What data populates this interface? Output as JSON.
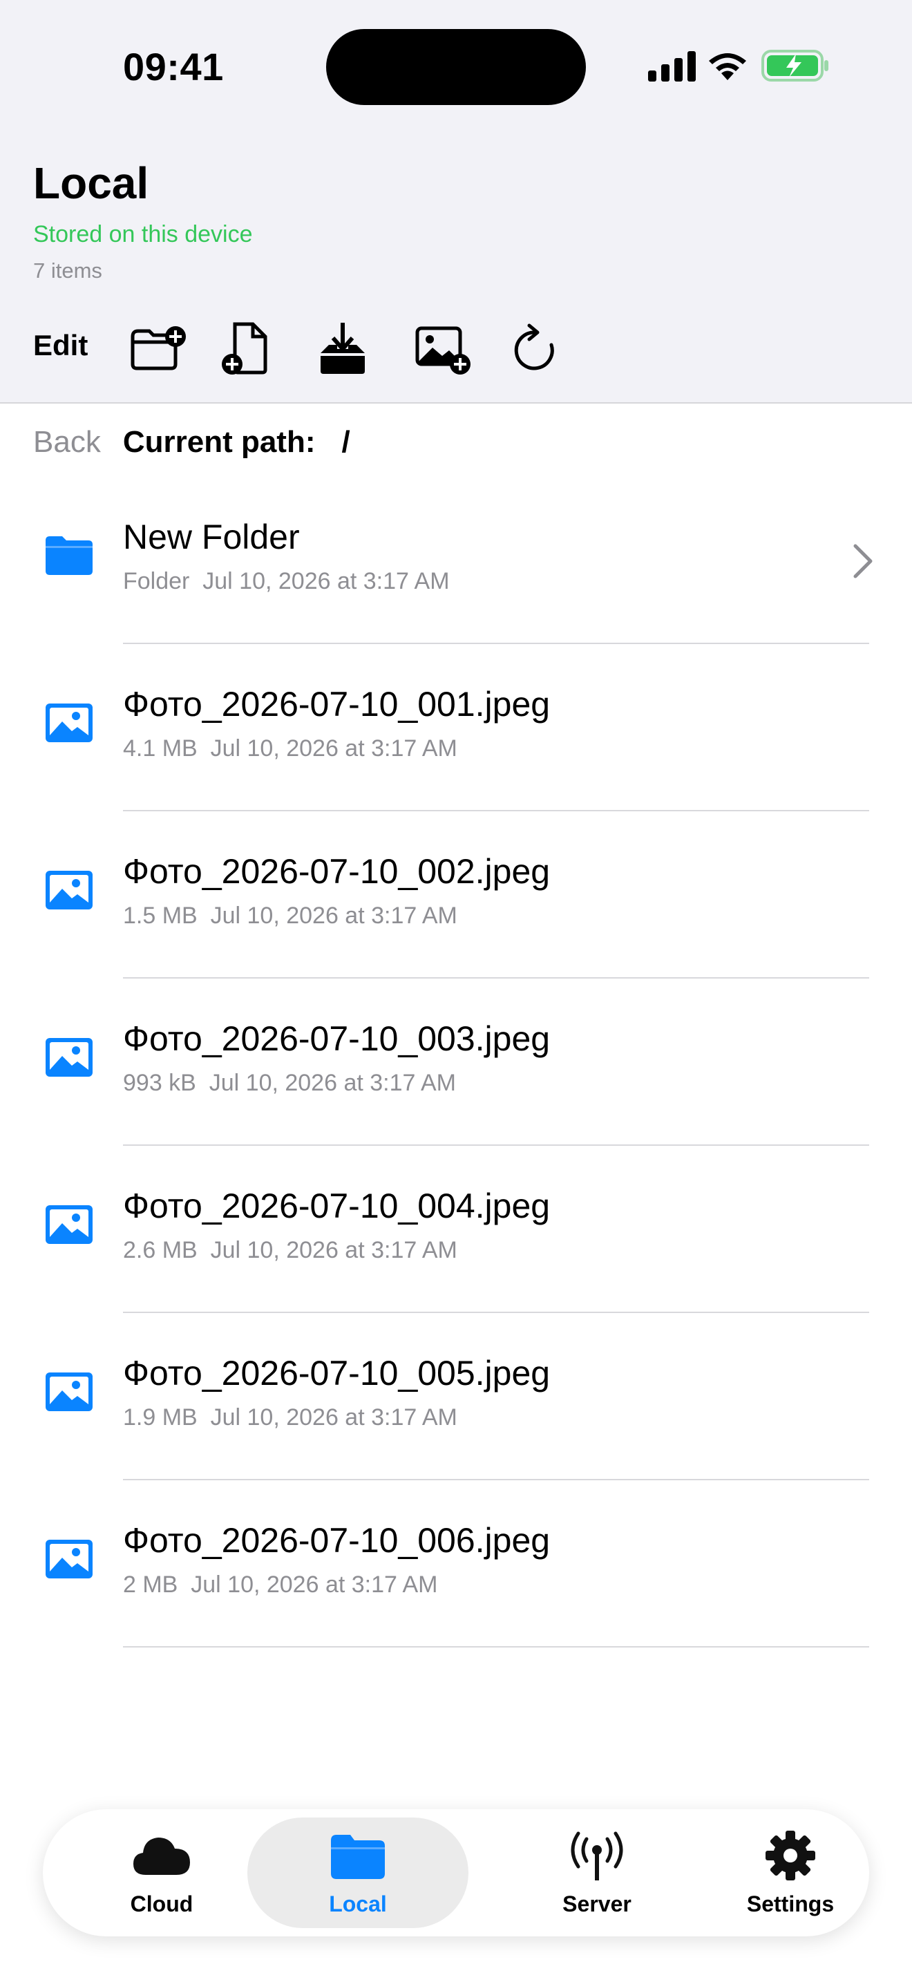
{
  "status": {
    "time": "09:41"
  },
  "header": {
    "title": "Local",
    "subtitle": "Stored on this device",
    "count": "7 items"
  },
  "toolbar": {
    "edit_label": "Edit",
    "icons": [
      "new-folder-icon",
      "new-file-icon",
      "import-icon",
      "add-photo-icon",
      "refresh-icon"
    ]
  },
  "path": {
    "back_label": "Back",
    "current_label": "Current path:",
    "current_value": "/"
  },
  "files": [
    {
      "name": "New Folder",
      "meta": "Folder  Jul 10, 2026 at 3:17 AM",
      "type": "folder"
    },
    {
      "name": "Фото_2026-07-10_001.jpeg",
      "meta": "4.1 MB  Jul 10, 2026 at 3:17 AM",
      "type": "image"
    },
    {
      "name": "Фото_2026-07-10_002.jpeg",
      "meta": "1.5 MB  Jul 10, 2026 at 3:17 AM",
      "type": "image"
    },
    {
      "name": "Фото_2026-07-10_003.jpeg",
      "meta": "993 kB  Jul 10, 2026 at 3:17 AM",
      "type": "image"
    },
    {
      "name": "Фото_2026-07-10_004.jpeg",
      "meta": "2.6 MB  Jul 10, 2026 at 3:17 AM",
      "type": "image"
    },
    {
      "name": "Фото_2026-07-10_005.jpeg",
      "meta": "1.9 MB  Jul 10, 2026 at 3:17 AM",
      "type": "image"
    },
    {
      "name": "Фото_2026-07-10_006.jpeg",
      "meta": "2 MB  Jul 10, 2026 at 3:17 AM",
      "type": "image"
    }
  ],
  "tabs": [
    {
      "label": "Cloud",
      "icon": "cloud-icon"
    },
    {
      "label": "Local",
      "icon": "folder-icon",
      "active": true
    },
    {
      "label": "Server",
      "icon": "antenna-icon"
    },
    {
      "label": "Settings",
      "icon": "gear-icon"
    }
  ],
  "colors": {
    "accent": "#0a84ff",
    "green": "#34c759",
    "secondary": "#8e8e93"
  }
}
